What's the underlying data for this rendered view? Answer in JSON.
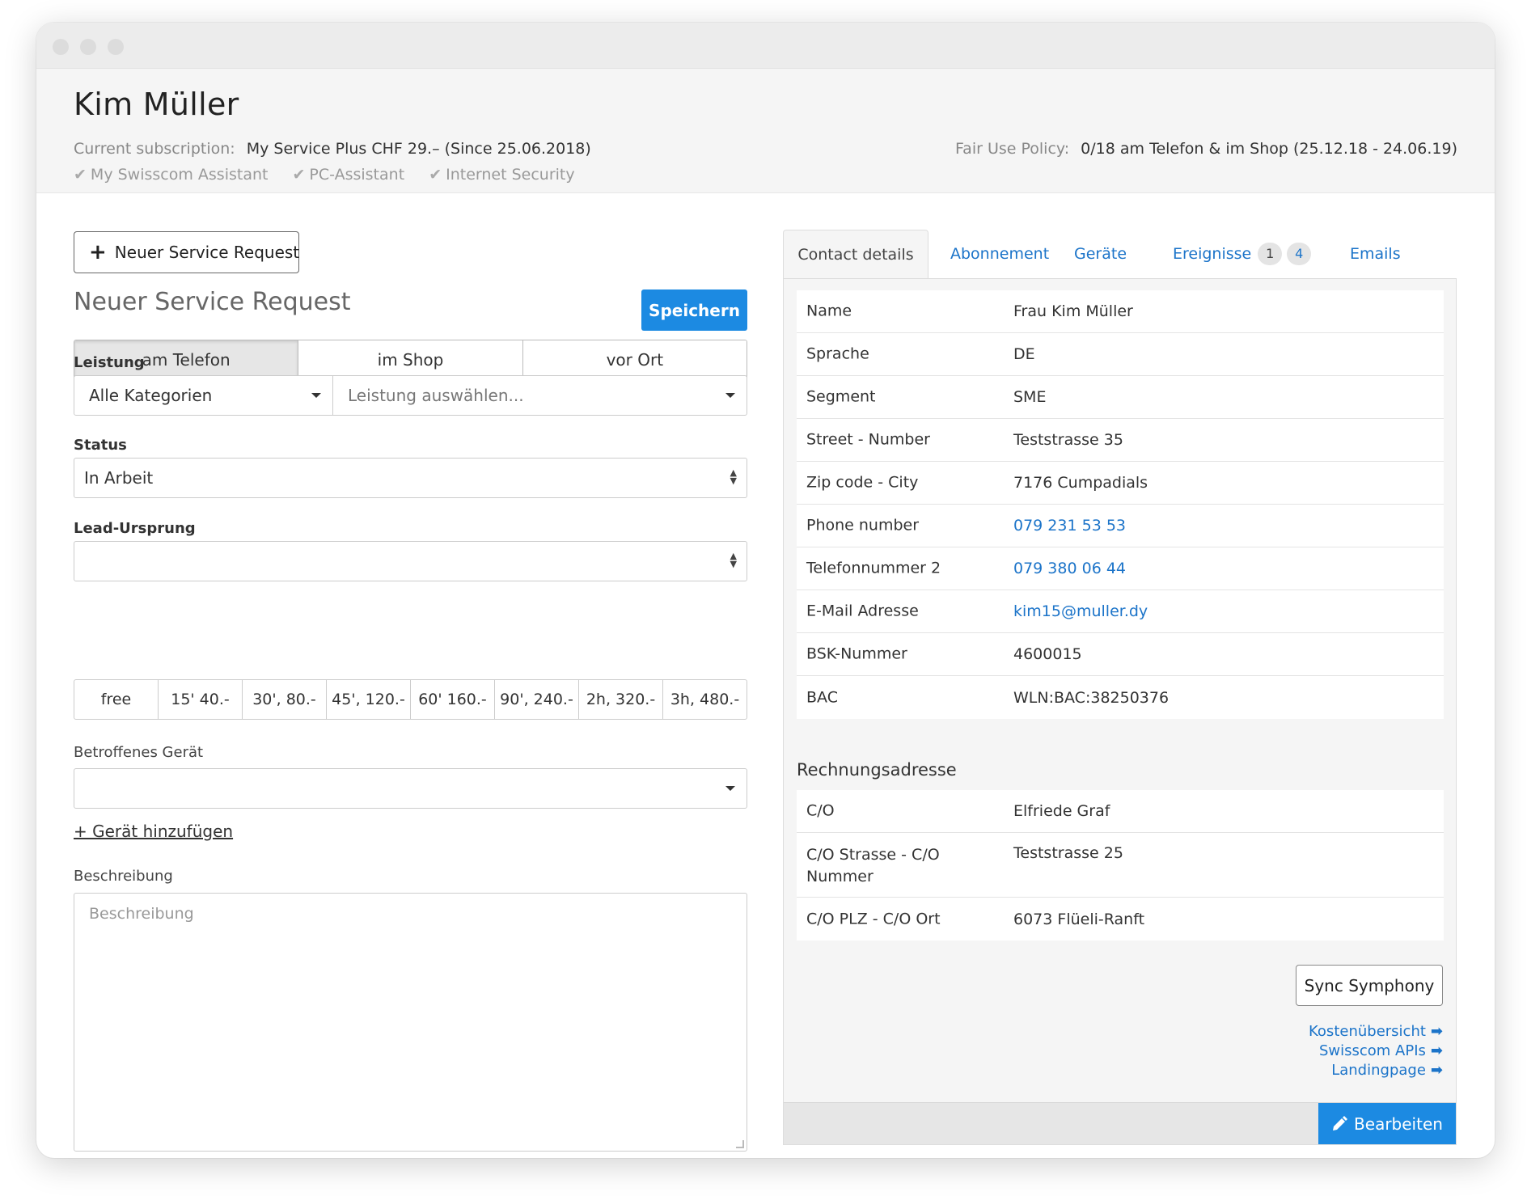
{
  "header": {
    "customer_name": "Kim Müller",
    "subscription_label": "Current subscription:",
    "subscription_value": "My Service Plus CHF 29.– (Since 25.06.2018)",
    "addons": [
      "My Swisscom Assistant",
      "PC-Assistant",
      "Internet Security"
    ],
    "fair_use_label": "Fair Use Policy:",
    "fair_use_value": "0/18 am Telefon & im Shop  (25.12.18 - 24.06.19)"
  },
  "left": {
    "new_button_label": "Neuer Service Request",
    "title": "Neuer Service Request",
    "save_label": "Speichern",
    "channels": [
      "am Telefon",
      "im Shop",
      "vor Ort"
    ],
    "active_channel": "am Telefon",
    "leistung_label": "Leistung",
    "category_value": "Alle Kategorien",
    "service_placeholder": "Leistung auswählen...",
    "status_label": "Status",
    "status_value": "In Arbeit",
    "lead_label": "Lead-Ursprung",
    "lead_value": "",
    "prices": [
      "free",
      "15' 40.-",
      "30', 80.-",
      "45', 120.-",
      "60' 160.-",
      "90', 240.-",
      "2h, 320.-",
      "3h, 480.-"
    ],
    "device_label": "Betroffenes Gerät",
    "device_value": "",
    "add_device_label": "+ Gerät hinzufügen",
    "description_label": "Beschreibung",
    "description_placeholder": "Beschreibung"
  },
  "tabs": {
    "contact": "Contact details",
    "abo": "Abonnement",
    "devices": "Geräte",
    "events": "Ereignisse",
    "events_badge_1": "1",
    "events_badge_2": "4",
    "emails": "Emails"
  },
  "contact_rows": [
    {
      "key": "Name",
      "value": "Frau Kim Müller"
    },
    {
      "key": "Sprache",
      "value": "DE"
    },
    {
      "key": "Segment",
      "value": "SME"
    },
    {
      "key": "Street - Number",
      "value": "Teststrasse 35"
    },
    {
      "key": "Zip code - City",
      "value": "7176 Cumpadials"
    },
    {
      "key": "Phone number",
      "value": "079 231 53 53"
    },
    {
      "key": "Telefonnummer 2",
      "value": "079 380 06 44"
    },
    {
      "key": "E-Mail Adresse",
      "value": "kim15@muller.dy"
    },
    {
      "key": "BSK-Nummer",
      "value": "4600015"
    },
    {
      "key": "BAC",
      "value": "WLN:BAC:38250376"
    }
  ],
  "billing": {
    "title": "Rechnungsadresse",
    "rows": [
      {
        "key": "C/O",
        "value": "Elfriede Graf"
      },
      {
        "key": "C/O Strasse - C/O Nummer",
        "value": "Teststrasse 25"
      },
      {
        "key": "C/O PLZ - C/O Ort",
        "value": "6073 Flüeli-Ranft"
      }
    ]
  },
  "actions": {
    "sync_label": "Sync Symphony",
    "links": [
      "Kostenübersicht",
      "Swisscom APIs",
      "Landingpage"
    ],
    "edit_label": "Bearbeiten"
  },
  "colors": {
    "accent": "#1c8ae2",
    "link": "#1c74c9"
  }
}
